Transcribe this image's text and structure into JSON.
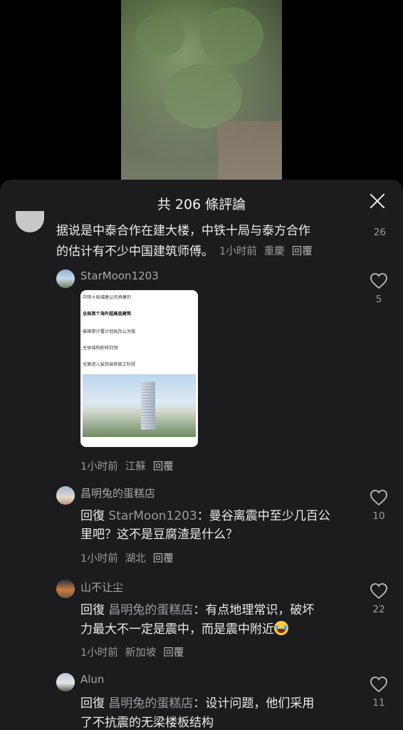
{
  "header": {
    "title": "共 206 條評論"
  },
  "top_comment": {
    "text_line1": "据说是中泰合作在建大楼，中铁十局与泰方合作",
    "text_line2": "的估计有不少中国建筑师傅。",
    "time": "1小时前",
    "location": "重慶",
    "reply": "回覆",
    "likes": "26"
  },
  "comments": [
    {
      "user": "StarMoon1203",
      "image_lines": [
        "中铁十局城建公司承建的",
        "全局首个海外超高层建筑",
        "泰国审计署计划局办公大楼",
        "主体结构即将封顶",
        "全面进入装饰装修施工阶段"
      ],
      "time": "1小时前",
      "location": "江蘇",
      "reply": "回覆",
      "likes": "5"
    },
    {
      "user": "昌明兔的蛋糕店",
      "reply_prefix": "回復",
      "mention": "StarMoon1203",
      "text_line1": "：曼谷离震中至少几百公",
      "text_line2": "里吧？这不是豆腐渣是什么？",
      "time": "1小时前",
      "location": "湖北",
      "reply": "回覆",
      "likes": "10"
    },
    {
      "user": "山不让尘",
      "reply_prefix": "回復",
      "mention": "昌明兔的蛋糕店",
      "text_line1": "：有点地理常识，破坏",
      "text_line2": "力最大不一定是震中，而是震中附近",
      "time": "1小时前",
      "location": "新加坡",
      "reply": "回覆",
      "likes": "22"
    },
    {
      "user": "Alun",
      "reply_prefix": "回復",
      "mention": "昌明兔的蛋糕店",
      "text_line1": "：设计问题，他们采用",
      "text_line2": "了不抗震的无梁楼板结构",
      "likes": "11"
    }
  ],
  "icons": {
    "like": "heart-outline-icon",
    "close": "close-icon",
    "emoji": "crying-laughing-emoji-icon"
  },
  "colors": {
    "sheet_bg": "#1c1c1f",
    "text": "#ececec",
    "meta": "#9a9a9e"
  }
}
